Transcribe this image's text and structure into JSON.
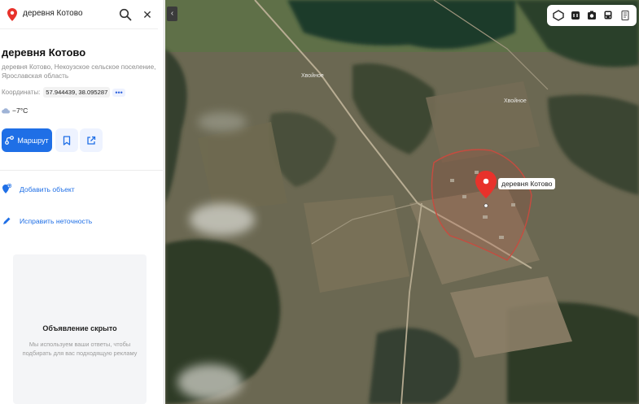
{
  "search": {
    "value": "деревня Котово"
  },
  "place": {
    "title": "деревня Котово",
    "address": "деревня Котово, Некоузское сельское поселение, Ярославская область",
    "coords_label": "Координаты:",
    "coords_value": "57.944439, 38.095287",
    "coords_more": "•••",
    "weather": "−7°C"
  },
  "buttons": {
    "route": "Маршрут"
  },
  "actions": [
    {
      "label": "Добавить объект",
      "icon": "add-pin-icon"
    },
    {
      "label": "Исправить неточность",
      "icon": "pencil-icon"
    }
  ],
  "ad": {
    "title": "Объявление скрыто",
    "text": "Мы используем ваши ответы, чтобы подбирать для вас подходящую рекламу"
  },
  "map": {
    "label": "деревня Котово",
    "faint_labels": [
      "Хвойное",
      "Хвойное"
    ],
    "toolbar_icons": [
      "layers-icon",
      "traffic-icon",
      "panorama-icon",
      "transit-icon",
      "ruler-icon"
    ],
    "pin_color": "#e8322b",
    "accent": "#1f6fe6"
  }
}
